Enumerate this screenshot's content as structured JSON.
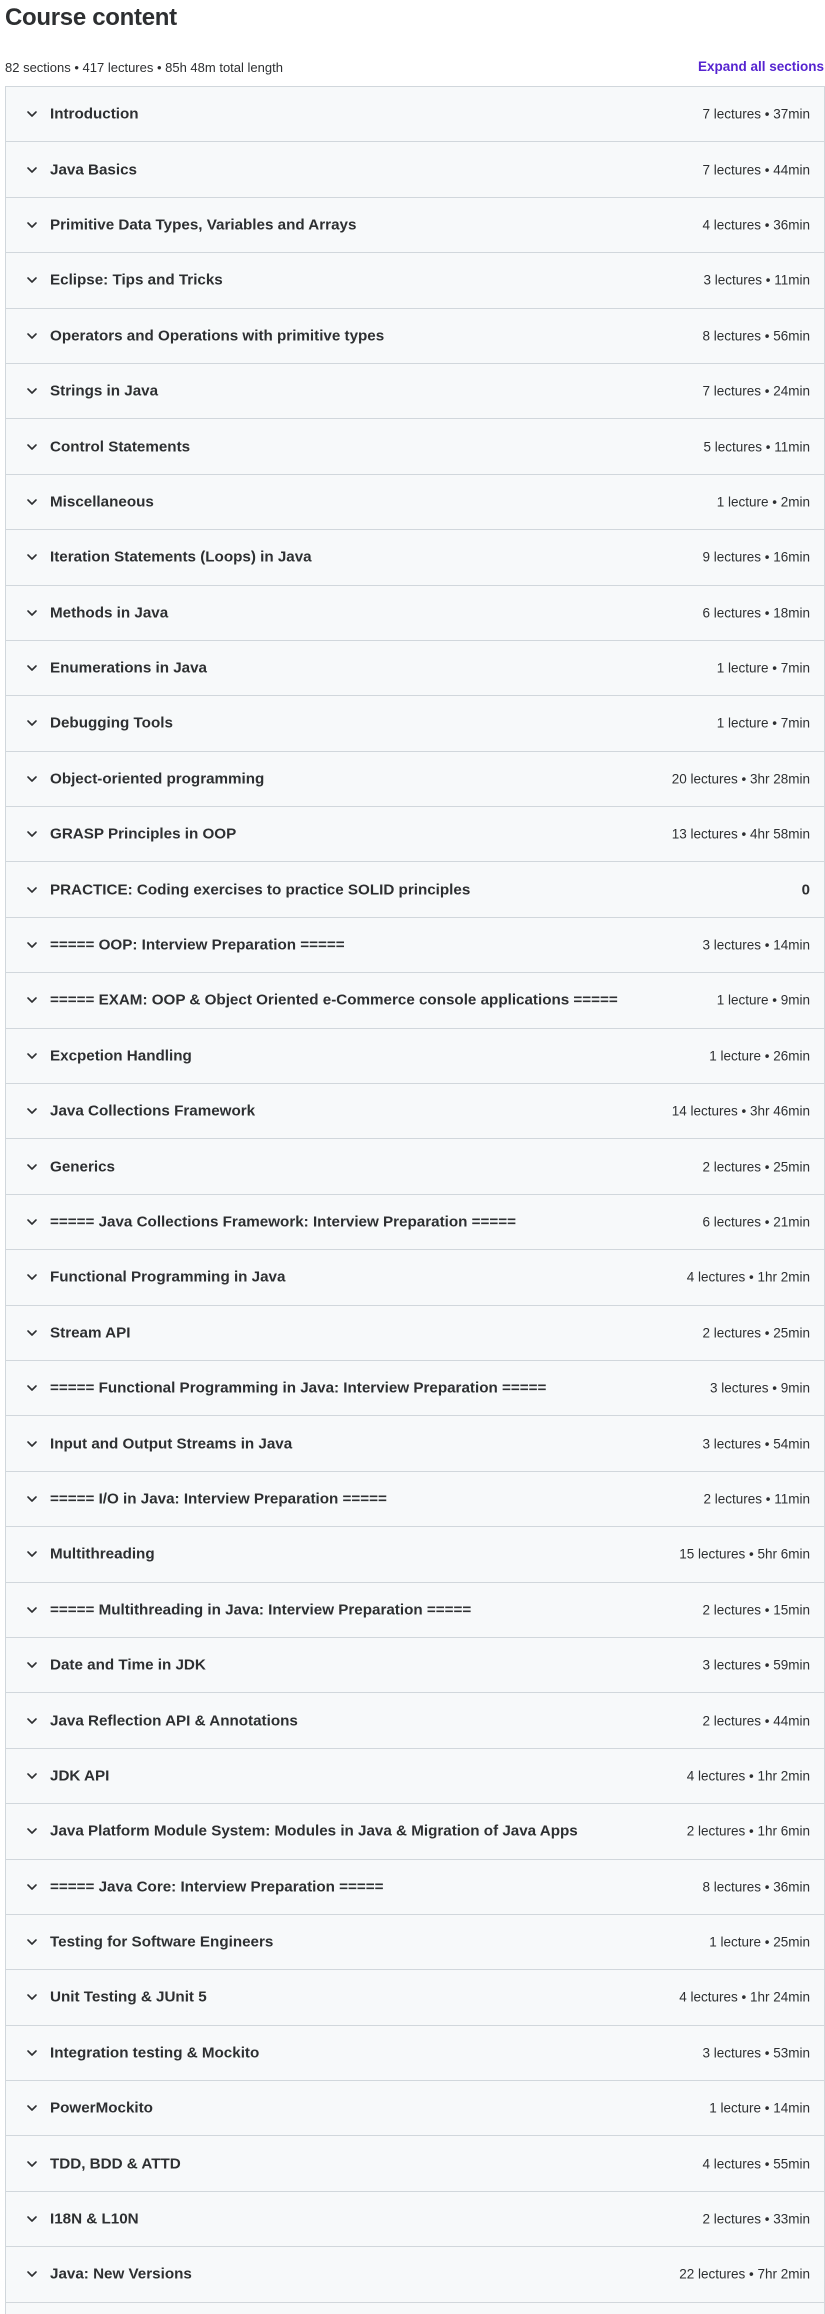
{
  "header": {
    "title": "Course content",
    "summary": "82 sections • 417 lectures • 85h 48m total length",
    "expand_all": "Expand all sections"
  },
  "colors": {
    "accent": "#5624d0",
    "row_bg": "#f7f9fa",
    "border": "#d1d7dc",
    "text": "#2d2f31"
  },
  "sections": [
    {
      "title": "Introduction",
      "meta": "7 lectures • 37min"
    },
    {
      "title": "Java Basics",
      "meta": "7 lectures • 44min"
    },
    {
      "title": "Primitive Data Types, Variables and Arrays",
      "meta": "4 lectures • 36min"
    },
    {
      "title": "Eclipse: Tips and Tricks",
      "meta": "3 lectures • 11min"
    },
    {
      "title": "Operators and Operations with primitive types",
      "meta": "8 lectures • 56min"
    },
    {
      "title": "Strings in Java",
      "meta": "7 lectures • 24min"
    },
    {
      "title": "Control Statements",
      "meta": "5 lectures • 11min"
    },
    {
      "title": "Miscellaneous",
      "meta": "1 lecture • 2min"
    },
    {
      "title": "Iteration Statements (Loops) in Java",
      "meta": "9 lectures • 16min"
    },
    {
      "title": "Methods in Java",
      "meta": "6 lectures • 18min"
    },
    {
      "title": "Enumerations in Java",
      "meta": "1 lecture • 7min"
    },
    {
      "title": "Debugging Tools",
      "meta": "1 lecture • 7min"
    },
    {
      "title": "Object-oriented programming",
      "meta": "20 lectures • 3hr 28min"
    },
    {
      "title": "GRASP Principles in OOP",
      "meta": "13 lectures • 4hr 58min"
    },
    {
      "title": "PRACTICE: Coding exercises to practice SOLID principles",
      "meta": "0"
    },
    {
      "title": "===== OOP: Interview Preparation =====",
      "meta": "3 lectures • 14min"
    },
    {
      "title": "===== EXAM: OOP & Object Oriented e-Commerce console applications =====",
      "meta": "1 lecture • 9min"
    },
    {
      "title": "Excpetion Handling",
      "meta": "1 lecture • 26min"
    },
    {
      "title": "Java Collections Framework",
      "meta": "14 lectures • 3hr 46min"
    },
    {
      "title": "Generics",
      "meta": "2 lectures • 25min"
    },
    {
      "title": "===== Java Collections Framework: Interview Preparation =====",
      "meta": "6 lectures • 21min"
    },
    {
      "title": "Functional Programming in Java",
      "meta": "4 lectures • 1hr 2min"
    },
    {
      "title": "Stream API",
      "meta": "2 lectures • 25min"
    },
    {
      "title": "===== Functional Programming in Java: Interview Preparation =====",
      "meta": "3 lectures • 9min"
    },
    {
      "title": "Input and Output Streams in Java",
      "meta": "3 lectures • 54min"
    },
    {
      "title": "===== I/O in Java: Interview Preparation =====",
      "meta": "2 lectures • 11min"
    },
    {
      "title": "Multithreading",
      "meta": "15 lectures • 5hr 6min"
    },
    {
      "title": "===== Multithreading in Java: Interview Preparation =====",
      "meta": "2 lectures • 15min"
    },
    {
      "title": "Date and Time in JDK",
      "meta": "3 lectures • 59min"
    },
    {
      "title": "Java Reflection API & Annotations",
      "meta": "2 lectures • 44min"
    },
    {
      "title": "JDK API",
      "meta": "4 lectures • 1hr 2min"
    },
    {
      "title": "Java Platform Module System: Modules in Java & Migration of Java Apps",
      "meta": "2 lectures • 1hr 6min"
    },
    {
      "title": "===== Java Core: Interview Preparation =====",
      "meta": "8 lectures • 36min"
    },
    {
      "title": "Testing for Software Engineers",
      "meta": "1 lecture • 25min"
    },
    {
      "title": "Unit Testing & JUnit 5",
      "meta": "4 lectures • 1hr 24min"
    },
    {
      "title": "Integration testing & Mockito",
      "meta": "3 lectures • 53min"
    },
    {
      "title": "PowerMockito",
      "meta": "1 lecture • 14min"
    },
    {
      "title": "TDD, BDD & ATTD",
      "meta": "4 lectures • 55min"
    },
    {
      "title": "I18N & L10N",
      "meta": "2 lectures • 33min"
    },
    {
      "title": "Java: New Versions",
      "meta": "22 lectures • 7hr 2min"
    },
    {
      "title": "",
      "meta": ""
    }
  ]
}
